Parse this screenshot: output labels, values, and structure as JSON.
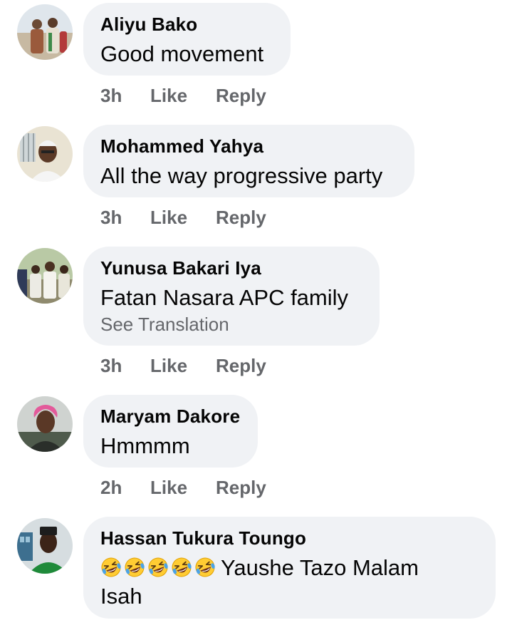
{
  "comments": [
    {
      "author": "Aliyu Bako",
      "text": "Good movement",
      "time": "3h",
      "like_label": "Like",
      "reply_label": "Reply"
    },
    {
      "author": "Mohammed Yahya",
      "text": "All the way progressive party",
      "time": "3h",
      "like_label": "Like",
      "reply_label": "Reply"
    },
    {
      "author": "Yunusa Bakari Iya",
      "text": "Fatan Nasara APC family",
      "translate_label": "See Translation",
      "time": "3h",
      "like_label": "Like",
      "reply_label": "Reply"
    },
    {
      "author": "Maryam Dakore",
      "text": "Hmmmm",
      "time": "2h",
      "like_label": "Like",
      "reply_label": "Reply"
    },
    {
      "author": "Hassan Tukura Toungo",
      "emoji": "rolling-on-floor-laughing-emoji",
      "emoji_count": 5,
      "text_line1": "Yaushe Tazo Malam",
      "text_line2": "Isah"
    }
  ],
  "colors": {
    "bubble": "#f0f2f5",
    "secondary_text": "#65676b",
    "primary_text": "#050505"
  }
}
